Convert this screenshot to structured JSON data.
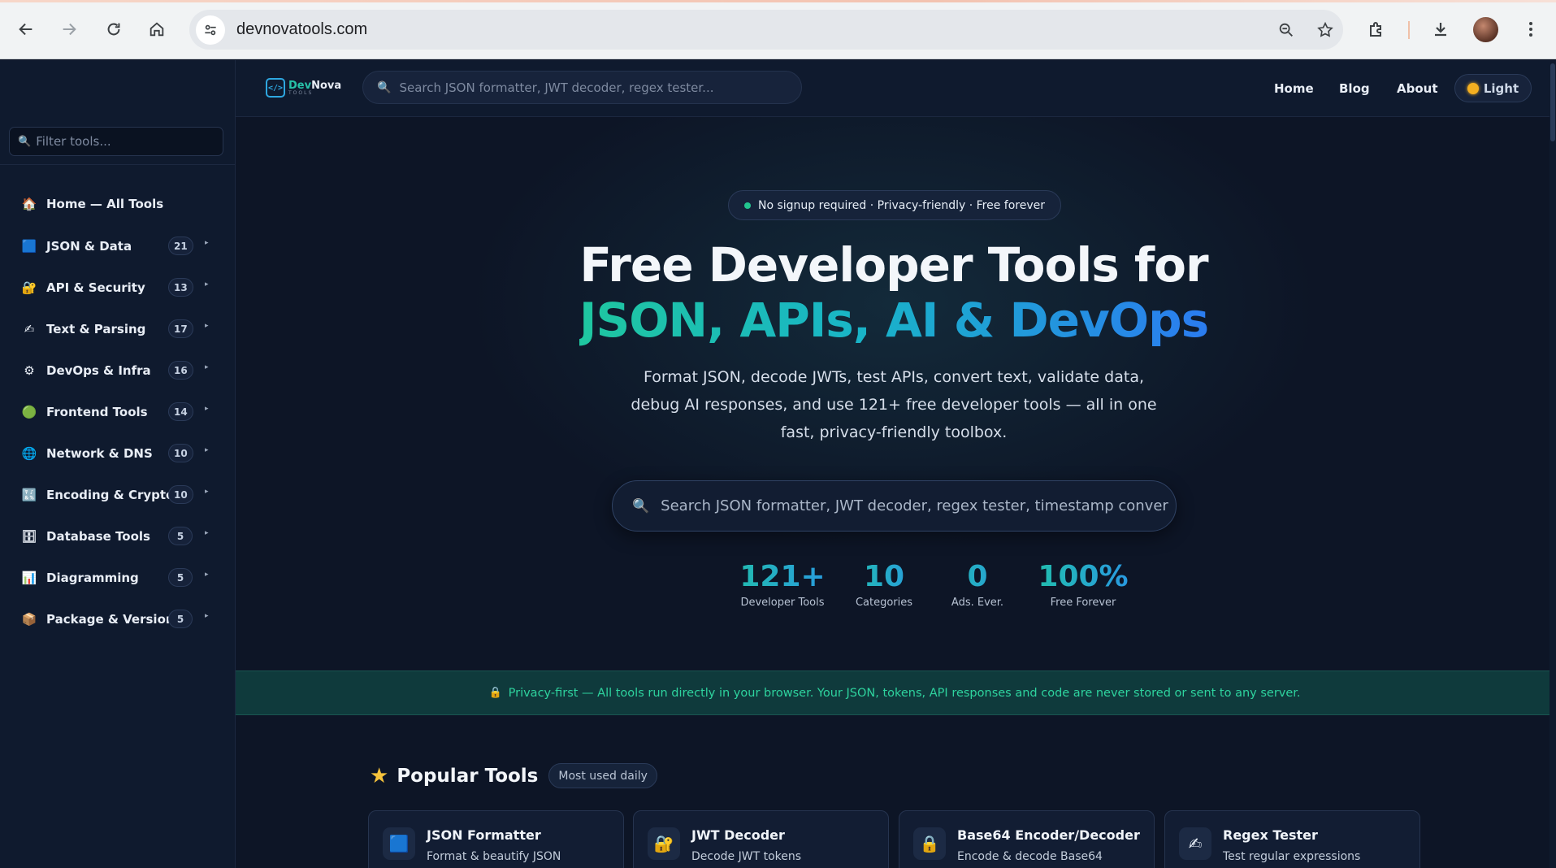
{
  "browser": {
    "url": "devnovatools.com",
    "back_icon": "arrow-left-icon",
    "forward_icon": "arrow-right-icon",
    "reload_icon": "reload-icon",
    "home_icon": "home-icon"
  },
  "sidebar": {
    "filter_placeholder": "Filter tools...",
    "items": [
      {
        "label": "Home — All Tools",
        "icon": "🏠",
        "count": null
      },
      {
        "label": "JSON & Data",
        "icon": "🟦",
        "count": "21"
      },
      {
        "label": "API & Security",
        "icon": "🔐",
        "count": "13"
      },
      {
        "label": "Text & Parsing",
        "icon": "✍",
        "count": "17"
      },
      {
        "label": "DevOps & Infra",
        "icon": "⚙",
        "count": "16"
      },
      {
        "label": "Frontend Tools",
        "icon": "🟢",
        "count": "14"
      },
      {
        "label": "Network & DNS",
        "icon": "🌐",
        "count": "10"
      },
      {
        "label": "Encoding & Crypto",
        "icon": "🔣",
        "count": "10"
      },
      {
        "label": "Database Tools",
        "icon": "🗄",
        "count": "5"
      },
      {
        "label": "Diagramming",
        "icon": "📊",
        "count": "5"
      },
      {
        "label": "Package & Version",
        "icon": "📦",
        "count": "5"
      }
    ]
  },
  "header": {
    "logo_dev": "Dev",
    "logo_nova": "Nova",
    "logo_sub": "TOOLS",
    "search_placeholder": "Search JSON formatter, JWT decoder, regex tester...",
    "nav": [
      "Home",
      "Blog",
      "About"
    ],
    "theme_label": "Light"
  },
  "hero": {
    "badge": "No signup required · Privacy-friendly · Free forever",
    "title_line1": "Free Developer Tools for",
    "title_line2": "JSON, APIs, AI & DevOps",
    "lead": "Format JSON, decode JWTs, test APIs, convert text, validate data, debug AI responses, and use 121+ free developer tools — all in one fast, privacy-friendly toolbox.",
    "search_placeholder": "Search JSON formatter, JWT decoder, regex tester, timestamp convert",
    "stats": [
      {
        "num": "121+",
        "label": "Developer Tools"
      },
      {
        "num": "10",
        "label": "Categories"
      },
      {
        "num": "0",
        "label": "Ads. Ever."
      },
      {
        "num": "100%",
        "label": "Free Forever"
      }
    ]
  },
  "privacy": {
    "text": "Privacy-first — All tools run directly in your browser. Your JSON, tokens, API responses and code are never stored or sent to any server."
  },
  "popular": {
    "title": "Popular Tools",
    "tag": "Most used daily",
    "cards": [
      {
        "title": "JSON Formatter",
        "desc": "Format & beautify JSON",
        "icon": "🟦"
      },
      {
        "title": "JWT Decoder",
        "desc": "Decode JWT tokens",
        "icon": "🔐"
      },
      {
        "title": "Base64 Encoder/Decoder",
        "desc": "Encode & decode Base64",
        "icon": "🔒"
      },
      {
        "title": "Regex Tester",
        "desc": "Test regular expressions",
        "icon": "✍"
      }
    ]
  }
}
